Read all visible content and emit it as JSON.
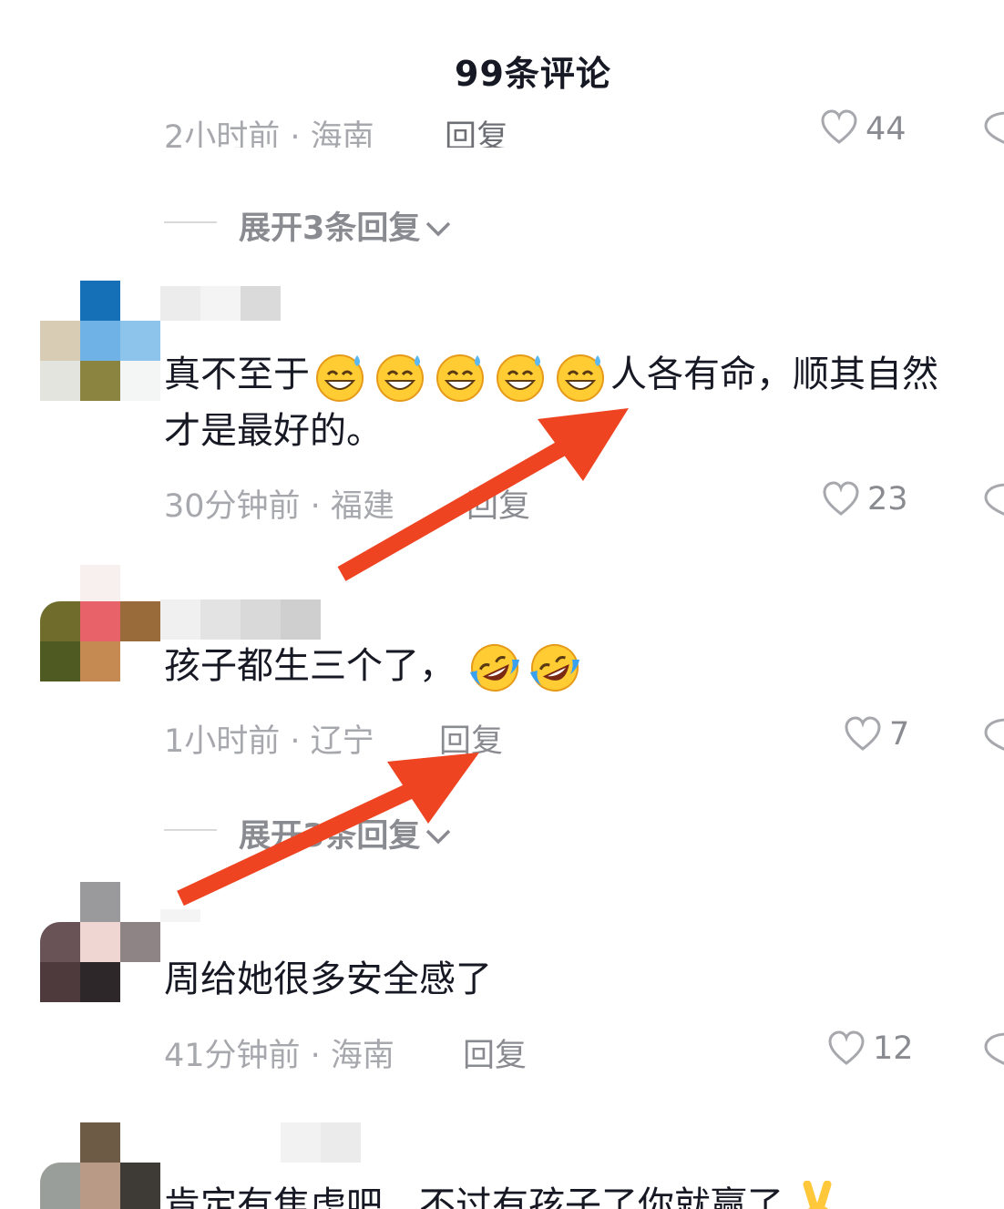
{
  "header": {
    "title": "99条评论"
  },
  "partial_top": {
    "time_location": "2小时前 · 海南",
    "reply": "回复",
    "likes": "44"
  },
  "expand_1": {
    "label": "展开3条回复"
  },
  "comments": [
    {
      "text_part1": "真不至于",
      "text_part2": "人各有命，顺其自然",
      "text_line2": "才是最好的。",
      "time_location": "30分钟前 · 福建",
      "reply": "回复",
      "likes": "23"
    },
    {
      "text": "孩子都生三个了，",
      "time_location": "1小时前 · 辽宁",
      "reply": "回复",
      "likes": "7"
    },
    {
      "text": "周给她很多安全感了",
      "time_location": "41分钟前 · 海南",
      "reply": "回复",
      "likes": "12"
    },
    {
      "text": "肯定有焦虑吧，不过有孩子了你就赢了"
    }
  ],
  "expand_2": {
    "label": "展开3条回复"
  },
  "colors": {
    "arrow": "#ee4422",
    "meta": "#a7a8ad",
    "text": "#161823"
  },
  "icons": [
    "heart-icon",
    "dislike-icon",
    "chevron-down-icon",
    "grinning-sweat-emoji",
    "rofl-emoji",
    "victory-hand-emoji"
  ]
}
